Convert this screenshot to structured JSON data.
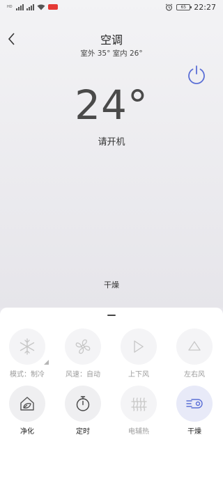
{
  "status_bar": {
    "time": "22:27",
    "battery": "65",
    "signal_label": "HD"
  },
  "header": {
    "title": "空调",
    "subtitle": "室外 35° 室内 26°"
  },
  "display": {
    "temperature": "24°",
    "hint": "请开机",
    "current_mode": "干燥"
  },
  "colors": {
    "accent": "#5b6fd6",
    "disabled_icon": "#c7c7c7",
    "active_icon": "#555555"
  },
  "controls": [
    {
      "label": "模式：制冷",
      "icon": "snowflake-icon",
      "enabled": false
    },
    {
      "label": "风速：自动",
      "icon": "fan-icon",
      "enabled": false
    },
    {
      "label": "上下风",
      "icon": "swing-vertical-icon",
      "enabled": false
    },
    {
      "label": "左右风",
      "icon": "swing-horizontal-icon",
      "enabled": false
    },
    {
      "label": "净化",
      "icon": "purify-icon",
      "enabled": true
    },
    {
      "label": "定时",
      "icon": "timer-icon",
      "enabled": true
    },
    {
      "label": "电辅热",
      "icon": "electric-heat-icon",
      "enabled": false
    },
    {
      "label": "干燥",
      "icon": "dry-icon",
      "enabled": true,
      "selected": true
    }
  ]
}
